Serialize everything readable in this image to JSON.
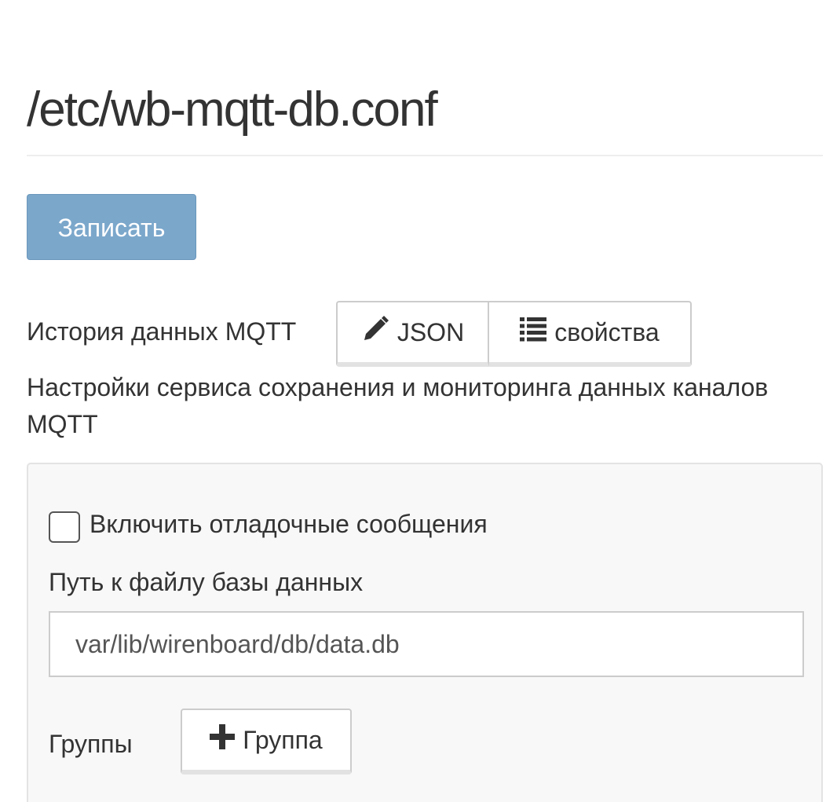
{
  "header": {
    "title": "/etc/wb-mqtt-db.conf"
  },
  "toolbar": {
    "save_label": "Записать"
  },
  "section": {
    "title": "История данных MQTT",
    "view_buttons": {
      "json_label": "JSON",
      "properties_label": "свойства"
    },
    "description": "Настройки сервиса сохранения и мониторинга данных каналов MQTT"
  },
  "form": {
    "debug_checkbox": {
      "label": "Включить отладочные сообщения",
      "checked": false
    },
    "db_path": {
      "label": "Путь к файлу базы данных",
      "value": "var/lib/wirenboard/db/data.db"
    },
    "groups": {
      "label": "Группы",
      "add_button_label": "Группа"
    }
  },
  "colors": {
    "primary_button": "#7ba7cb",
    "well_background": "#f8f8f8",
    "text": "#333333"
  }
}
